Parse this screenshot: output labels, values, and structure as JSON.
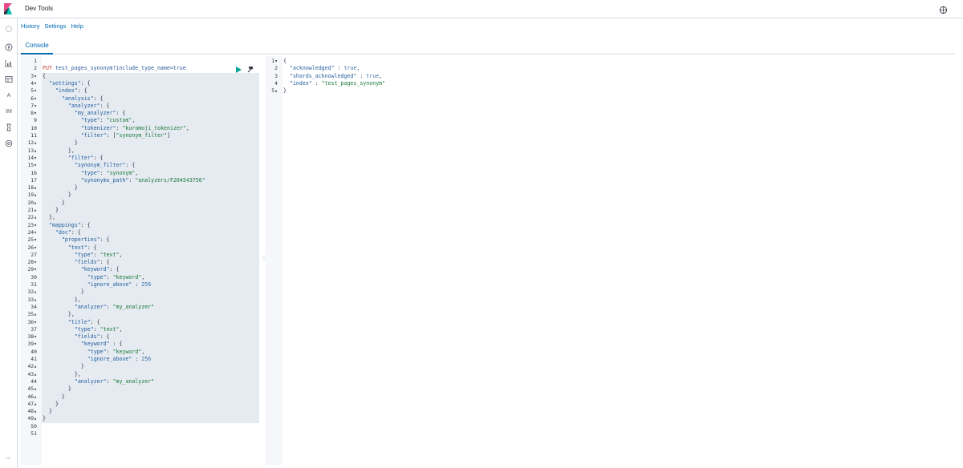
{
  "app": {
    "title": "Dev Tools"
  },
  "menu": {
    "history": "History",
    "settings": "Settings",
    "help": "Help"
  },
  "tabs": {
    "console": "Console"
  },
  "nav": {
    "item_a": "A",
    "item_im": "IM"
  },
  "colors": {
    "accent": "#006bb4",
    "method": "#c9473f",
    "string": "#197a38",
    "key": "#1f5d9c"
  },
  "request": {
    "lines": [
      {
        "n": "1",
        "text": ""
      },
      {
        "n": "2",
        "method": "PUT",
        "url": "test_pages_synonym?include_type_name=true"
      },
      {
        "n": "3▾",
        "text": "{"
      },
      {
        "n": "4▾",
        "text": "  \"settings\": {"
      },
      {
        "n": "5▾",
        "text": "    \"index\": {"
      },
      {
        "n": "6▾",
        "text": "      \"analysis\": {"
      },
      {
        "n": "7▾",
        "text": "        \"analyzer\": {"
      },
      {
        "n": "8▾",
        "text": "          \"my_analyzer\": {"
      },
      {
        "n": "9",
        "text": "            \"type\": \"custom\","
      },
      {
        "n": "10",
        "text": "            \"tokenizer\": \"kuromoji_tokenizer\","
      },
      {
        "n": "11",
        "text": "            \"filter\": [\"synonym_filter\"]"
      },
      {
        "n": "12▴",
        "text": "          }"
      },
      {
        "n": "13▴",
        "text": "        },"
      },
      {
        "n": "14▾",
        "text": "        \"filter\": {"
      },
      {
        "n": "15▾",
        "text": "          \"synonym_filter\": {"
      },
      {
        "n": "16",
        "text": "            \"type\": \"synonym\","
      },
      {
        "n": "17",
        "text": "            \"synonyms_path\": \"analyzers/F204543756\""
      },
      {
        "n": "18▴",
        "text": "          }"
      },
      {
        "n": "19▴",
        "text": "        }"
      },
      {
        "n": "20▴",
        "text": "      }"
      },
      {
        "n": "21▴",
        "text": "    }"
      },
      {
        "n": "22▴",
        "text": "  },"
      },
      {
        "n": "23▾",
        "text": "  \"mappings\": {"
      },
      {
        "n": "24▾",
        "text": "    \"doc\": {"
      },
      {
        "n": "25▾",
        "text": "      \"properties\": {"
      },
      {
        "n": "26▾",
        "text": "        \"text\": {"
      },
      {
        "n": "27",
        "text": "          \"type\": \"text\","
      },
      {
        "n": "28▾",
        "text": "          \"fields\": {"
      },
      {
        "n": "29▾",
        "text": "            \"keyword\": {"
      },
      {
        "n": "30",
        "text": "              \"type\": \"keyword\","
      },
      {
        "n": "31",
        "text": "              \"ignore_above\" : 256"
      },
      {
        "n": "32▴",
        "text": "            }"
      },
      {
        "n": "33▴",
        "text": "          },"
      },
      {
        "n": "34",
        "text": "          \"analyzer\": \"my_analyzer\""
      },
      {
        "n": "35▴",
        "text": "        },"
      },
      {
        "n": "36▾",
        "text": "        \"title\": {"
      },
      {
        "n": "37",
        "text": "          \"type\": \"text\","
      },
      {
        "n": "38▾",
        "text": "          \"fields\": {"
      },
      {
        "n": "39▾",
        "text": "            \"keyword\" : {"
      },
      {
        "n": "40",
        "text": "              \"type\": \"keyword\","
      },
      {
        "n": "41",
        "text": "              \"ignore_above\" : 256"
      },
      {
        "n": "42▴",
        "text": "            }"
      },
      {
        "n": "43▴",
        "text": "          },"
      },
      {
        "n": "44",
        "text": "          \"analyzer\": \"my_analyzer\""
      },
      {
        "n": "45▴",
        "text": "        }"
      },
      {
        "n": "46▴",
        "text": "      }"
      },
      {
        "n": "47▴",
        "text": "    }"
      },
      {
        "n": "48▴",
        "text": "  }"
      },
      {
        "n": "49▴",
        "text": "}"
      },
      {
        "n": "50",
        "text": ""
      },
      {
        "n": "51",
        "text": ""
      }
    ]
  },
  "response": {
    "lines": [
      {
        "n": "1▾",
        "text": "{"
      },
      {
        "n": "2",
        "text": "  \"acknowledged\" : true,"
      },
      {
        "n": "3",
        "text": "  \"shards_acknowledged\" : true,"
      },
      {
        "n": "4",
        "text": "  \"index\" : \"test_pages_synonym\""
      },
      {
        "n": "5▴",
        "text": "}"
      }
    ]
  }
}
